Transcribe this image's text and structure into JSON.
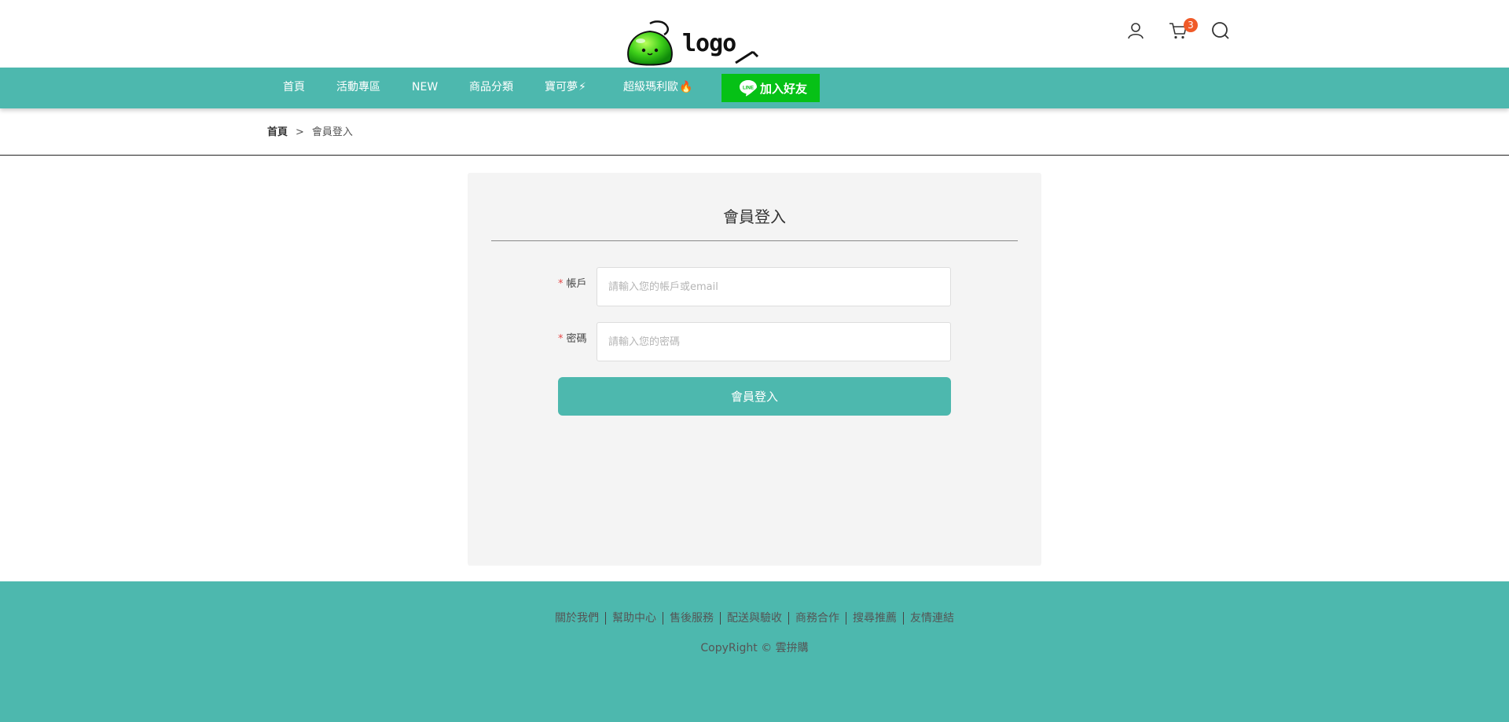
{
  "header": {
    "logo_text": "logo",
    "cart_count": "3"
  },
  "nav": {
    "items": [
      {
        "label": "首頁"
      },
      {
        "label": "活動專區"
      },
      {
        "label": "NEW"
      },
      {
        "label": "商品分類"
      },
      {
        "label": "寶可夢",
        "emoji": "⚡"
      },
      {
        "label": "超級瑪利歐",
        "emoji": "🔥"
      }
    ],
    "line_badge": "LINE",
    "line_label": "加入好友"
  },
  "breadcrumb": {
    "home": "首頁",
    "separator": ">",
    "current": "會員登入"
  },
  "login": {
    "title": "會員登入",
    "required_mark": "*",
    "account_label": "帳戶",
    "account_placeholder": "請輸入您的帳戶或email",
    "password_label": "密碼",
    "password_placeholder": "請輸入您的密碼",
    "submit_label": "會員登入"
  },
  "footer": {
    "links": [
      "關於我們",
      "幫助中心",
      "售後服務",
      "配送與驗收",
      "商務合作",
      "搜尋推薦",
      "友情連結"
    ],
    "copyright": "CopyRight © 雲拚購"
  },
  "colors": {
    "brand_teal": "#4db8ae",
    "line_green": "#06c116",
    "badge_orange": "#f05a28",
    "required_red": "#e54848"
  }
}
